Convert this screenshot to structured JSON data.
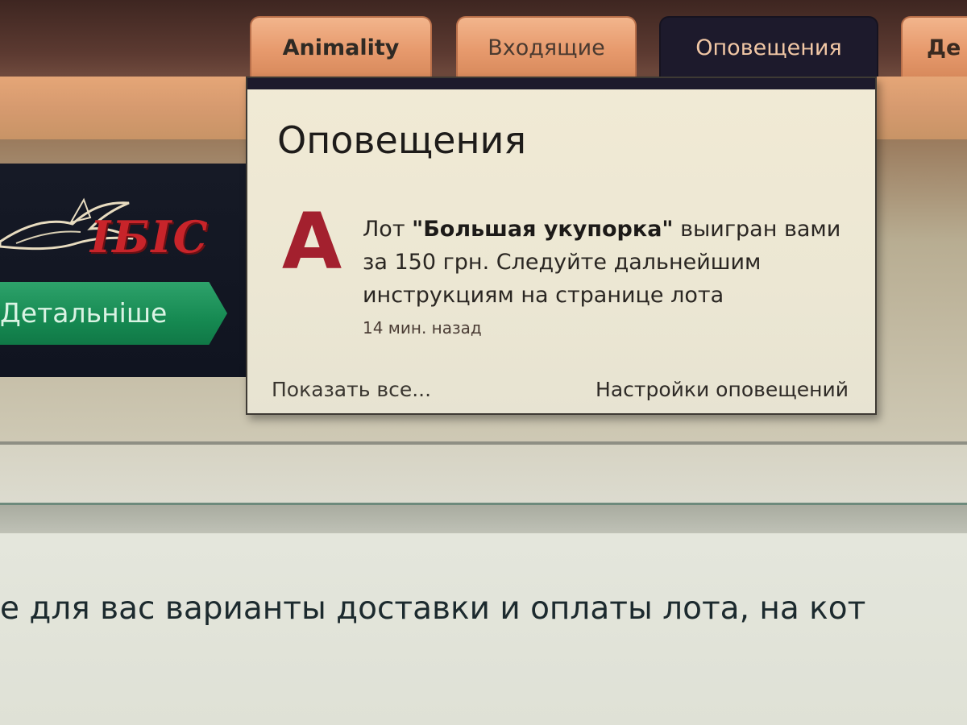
{
  "tabs": {
    "animality": "Animality",
    "inbox": "Входящие",
    "alerts": "Оповещения",
    "partial": "Де"
  },
  "banner": {
    "logo_text": "IБIС",
    "detail_button": "Детальніше"
  },
  "notifications": {
    "title": "Оповещения",
    "avatar_letter": "A",
    "item": {
      "prefix": "Лот ",
      "lot_name": "\"Большая укупорка\"",
      "suffix": " выигран вами за 150 грн. Следуйте дальнейшим инструкциям на странице лота",
      "time": "14 мин. назад"
    },
    "show_all": "Показать все...",
    "settings": "Настройки оповещений"
  },
  "content": {
    "text": "е для вас варианты доставки и оплаты лота, на кот"
  },
  "colors": {
    "tab_bg": "#e79a6d",
    "active_tab_bg": "#1d1a2c",
    "logo_red": "#c8242a",
    "button_green": "#168a52",
    "avatar_red": "#a3202e"
  }
}
